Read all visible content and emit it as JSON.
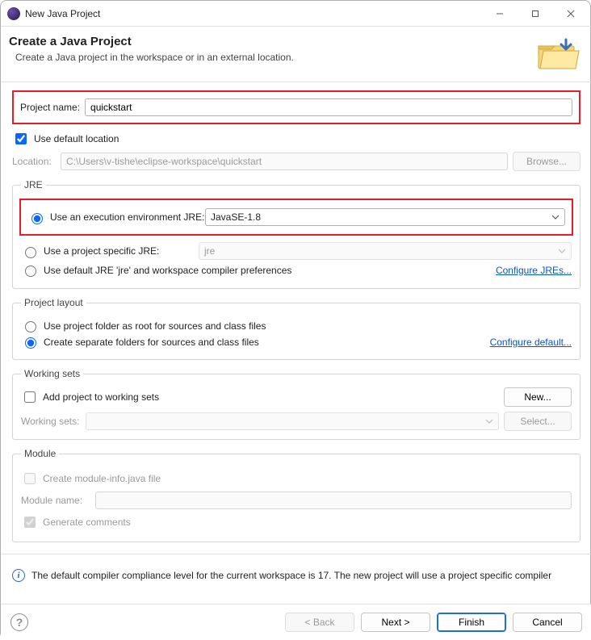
{
  "window": {
    "title": "New Java Project"
  },
  "header": {
    "title": "Create a Java Project",
    "subtitle": "Create a Java project in the workspace or in an external location."
  },
  "project": {
    "name_label": "Project name:",
    "name_value": "quickstart",
    "use_default_location_label": "Use default location",
    "use_default_location_checked": true,
    "location_label": "Location:",
    "location_value": "C:\\Users\\v-tishe\\eclipse-workspace\\quickstart",
    "browse_label": "Browse..."
  },
  "jre": {
    "legend": "JRE",
    "env_label": "Use an execution environment JRE:",
    "env_value": "JavaSE-1.8",
    "project_specific_label": "Use a project specific JRE:",
    "project_specific_value": "jre",
    "default_label": "Use default JRE 'jre' and workspace compiler preferences",
    "configure_link": "Configure JREs..."
  },
  "layout": {
    "legend": "Project layout",
    "root_label": "Use project folder as root for sources and class files",
    "separate_label": "Create separate folders for sources and class files",
    "configure_link": "Configure default..."
  },
  "working_sets": {
    "legend": "Working sets",
    "add_label": "Add project to working sets",
    "new_label": "New...",
    "ws_label": "Working sets:",
    "select_label": "Select..."
  },
  "module": {
    "legend": "Module",
    "create_info_label": "Create module-info.java file",
    "module_name_label": "Module name:",
    "module_name_value": "",
    "generate_comments_label": "Generate comments"
  },
  "info": {
    "text": "The default compiler compliance level for the current workspace is 17. The new project will use a project specific compiler"
  },
  "footer": {
    "back": "< Back",
    "next": "Next >",
    "finish": "Finish",
    "cancel": "Cancel"
  }
}
